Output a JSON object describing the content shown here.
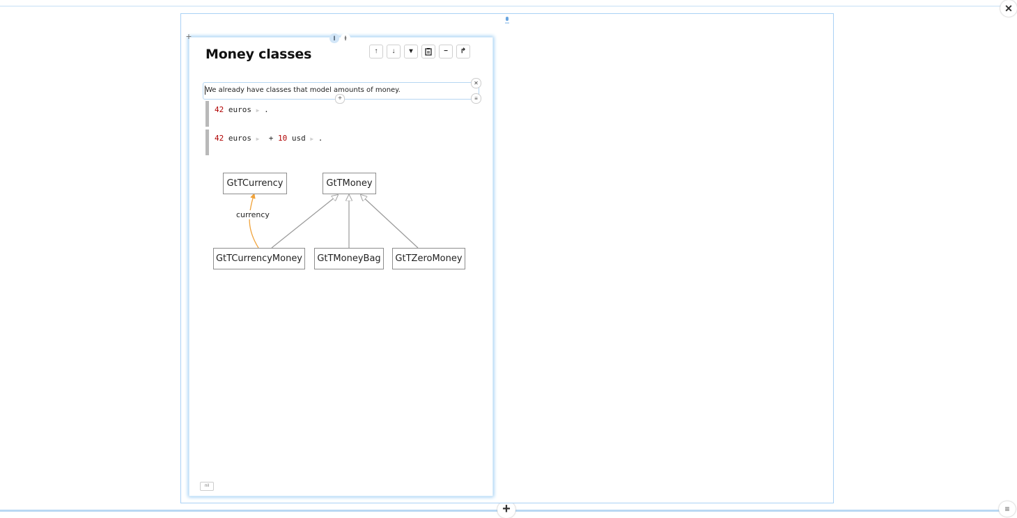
{
  "page": {
    "title": "Money classes",
    "toolbar_icons": [
      "arrow-up-icon",
      "arrow-down-icon",
      "dropdown-icon",
      "clipboard-icon",
      "minus-icon",
      "share-icon"
    ]
  },
  "text_snippet": {
    "text": "We already have classes that model amounts of money."
  },
  "code_snippets": [
    {
      "number": "42",
      "unit": "euros",
      "end": "."
    },
    {
      "number1": "42",
      "unit1": "euros",
      "op": "+",
      "number2": "10",
      "unit2": "usd",
      "end": "."
    }
  ],
  "diagram": {
    "classes": [
      "GtTCurrency",
      "GtTMoney",
      "GtTCurrencyMoney",
      "GtTMoneyBag",
      "GtTZeroMoney"
    ],
    "edge_label": "currency",
    "colors": {
      "association": "#f0a23a",
      "inheritance": "#9a9a9a"
    }
  },
  "footer_badge": "nil",
  "colors": {
    "accent": "#9ccdf2",
    "number": "#b00000"
  }
}
